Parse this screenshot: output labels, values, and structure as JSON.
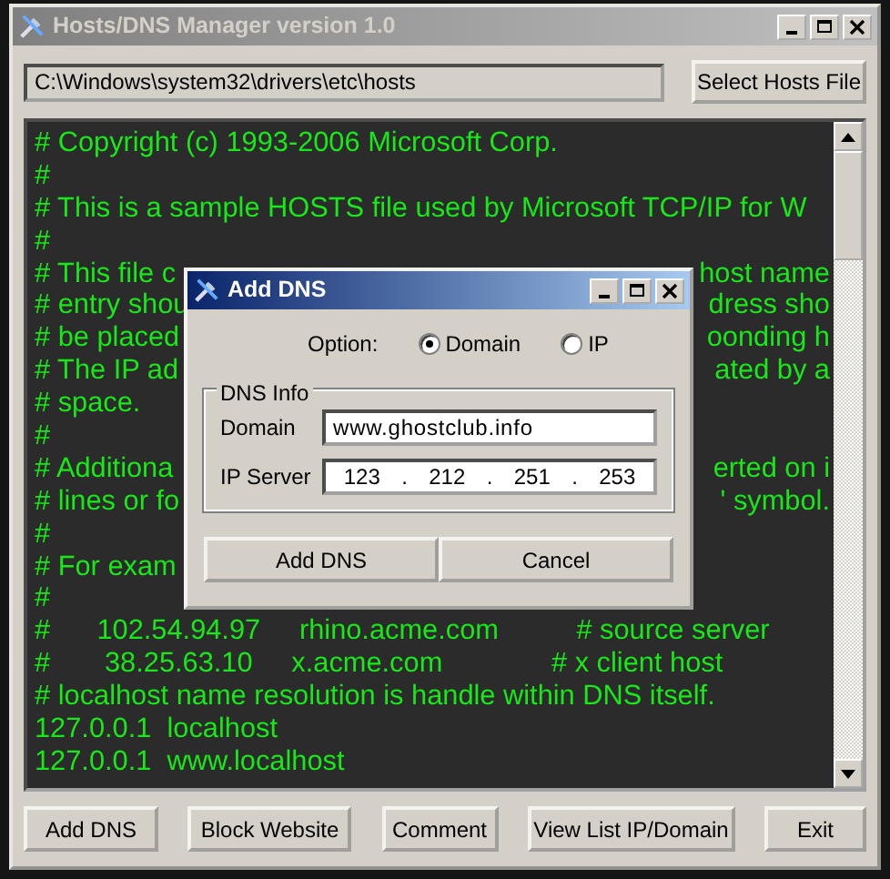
{
  "window": {
    "title": "Hosts/DNS Manager version 1.0"
  },
  "path_field": {
    "value": "C:\\Windows\\system32\\drivers\\etc\\hosts"
  },
  "select_button": "Select Hosts File",
  "hosts_lines": [
    {
      "left": "# Copyright (c) 1993-2006 Microsoft Corp."
    },
    {
      "left": "#"
    },
    {
      "left": "# This is a sample HOSTS file used by Microsoft TCP/IP for W"
    },
    {
      "left": "#"
    },
    {
      "left": "# This file c",
      "right": "host name"
    },
    {
      "left": "# entry shou",
      "right": "dress sho"
    },
    {
      "left": "# be placed",
      "right": "oonding h"
    },
    {
      "left": "# The IP ad",
      "right": "ated by a"
    },
    {
      "left": "# space."
    },
    {
      "left": "#"
    },
    {
      "left": "# Additiona",
      "right": "erted on i"
    },
    {
      "left": "# lines or fo",
      "right": "' symbol."
    },
    {
      "left": "#"
    },
    {
      "left": "# For exam"
    },
    {
      "left": "#"
    },
    {
      "left": "#      102.54.94.97     rhino.acme.com          # source server"
    },
    {
      "left": "#       38.25.63.10     x.acme.com              # x client host"
    },
    {
      "left": "# localhost name resolution is handle within DNS itself."
    },
    {
      "left": "127.0.0.1  localhost"
    },
    {
      "left": "127.0.0.1  www.localhost"
    }
  ],
  "bottom_buttons": [
    "Add DNS",
    "Block Website",
    "Comment",
    "View List IP/Domain",
    "Exit"
  ],
  "dialog": {
    "title": "Add DNS",
    "option_label": "Option:",
    "options": [
      {
        "label": "Domain",
        "selected": true
      },
      {
        "label": "IP",
        "selected": false
      }
    ],
    "group_title": "DNS Info",
    "domain_label": "Domain",
    "domain_value": "www.ghostclub.info",
    "ip_label": "IP Server",
    "ip_octets": [
      "123",
      "212",
      "251",
      "253"
    ],
    "ip_separator": ".",
    "buttons": [
      "Add DNS",
      "Cancel"
    ]
  }
}
